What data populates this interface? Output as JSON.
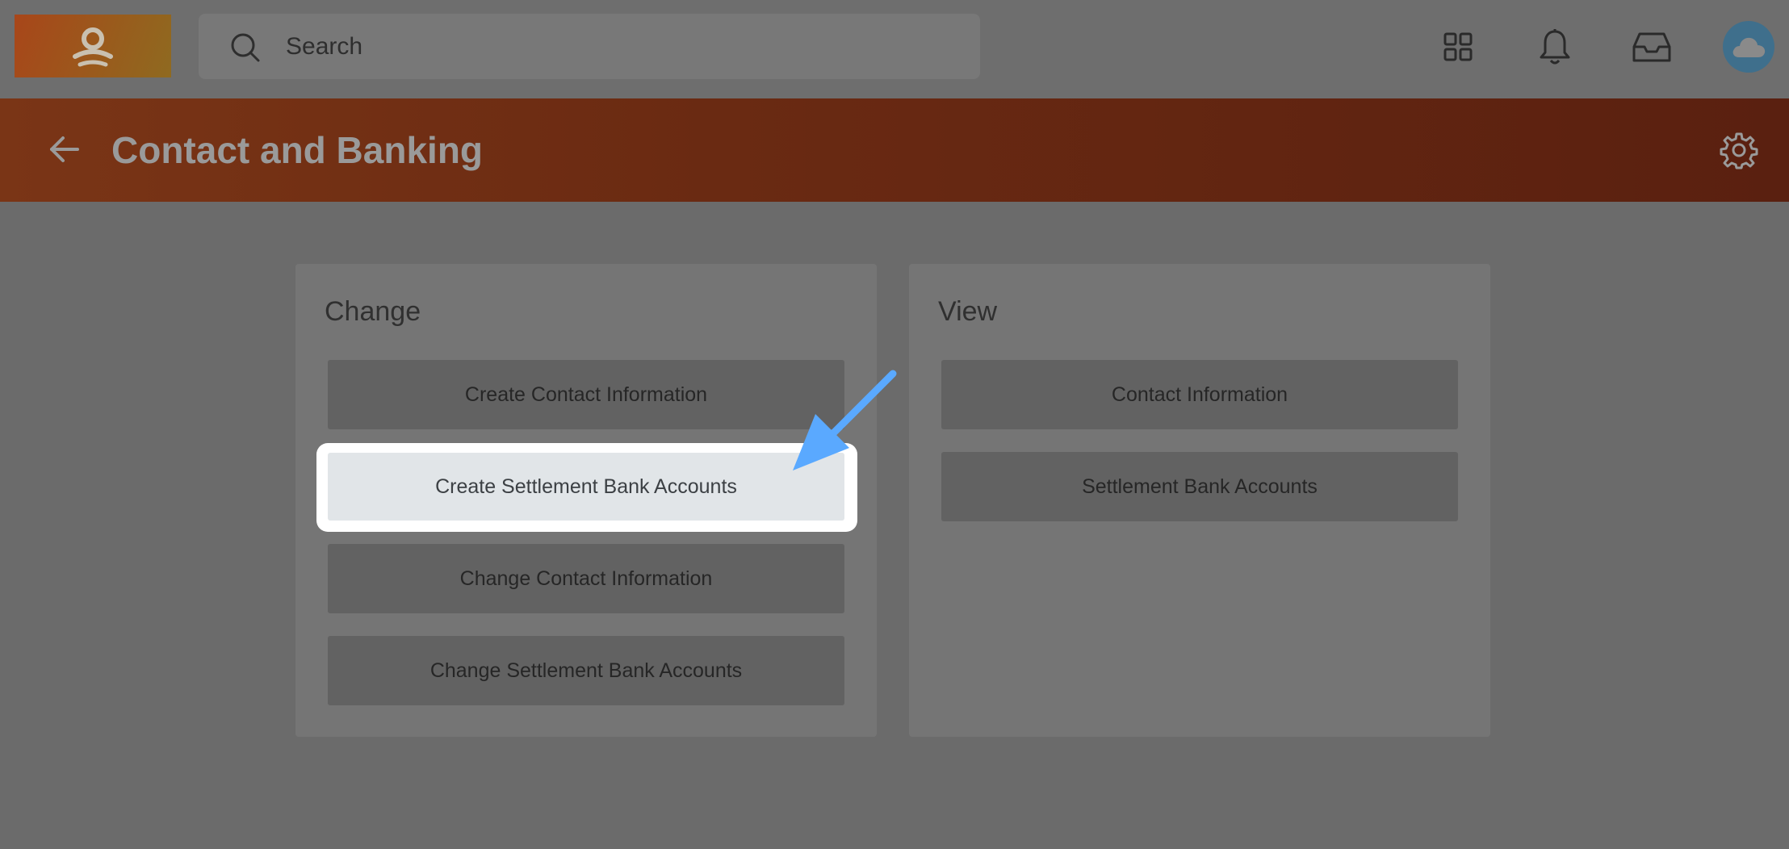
{
  "search": {
    "placeholder": "Search"
  },
  "header": {
    "title": "Contact and Banking"
  },
  "icons": {
    "logo": "person-logo-icon",
    "search": "search-icon",
    "apps": "grid-icon",
    "notifications": "bell-icon",
    "inbox": "inbox-icon",
    "avatar": "cloud-icon",
    "back": "arrow-left-icon",
    "settings": "gear-icon",
    "pointer": "blue-arrow-icon"
  },
  "colors": {
    "pointer_arrow": "#5aa9ff",
    "header": "#6a2a12",
    "highlight": "#ffffff"
  },
  "change_card": {
    "title": "Change",
    "buttons": [
      "Create Contact Information",
      "Create Settlement Bank Accounts",
      "Change Contact Information",
      "Change Settlement Bank Accounts"
    ]
  },
  "view_card": {
    "title": "View",
    "buttons": [
      "Contact Information",
      "Settlement Bank Accounts"
    ]
  }
}
